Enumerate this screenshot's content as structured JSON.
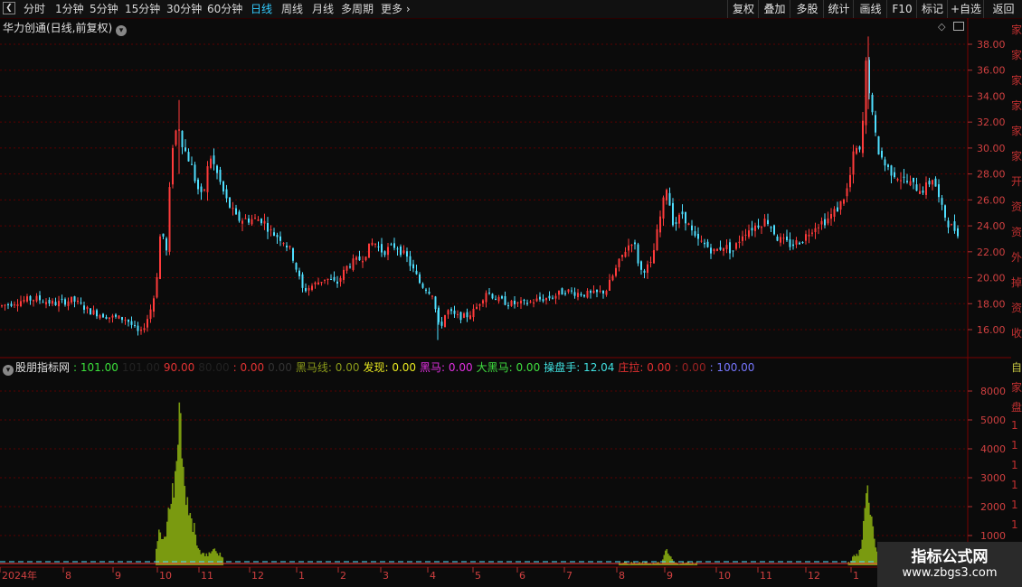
{
  "toolbar": {
    "periods": [
      "分时",
      "1分钟",
      "5分钟",
      "15分钟",
      "30分钟",
      "60分钟",
      "日线",
      "周线",
      "月线",
      "多周期",
      "更多"
    ],
    "active_period": "日线",
    "right_buttons": [
      "复权",
      "叠加",
      "多股",
      "统计",
      "画线",
      "F10",
      "标记",
      "+自选",
      "返回"
    ]
  },
  "stock": {
    "title": "华力创通(日线,前复权)"
  },
  "indicator": {
    "name": "股朋指标网",
    "items": [
      {
        "label": "",
        "value": ": 101.00",
        "color": "#3be03b"
      },
      {
        "label": "",
        "value": "101.00",
        "color": "#222222"
      },
      {
        "label": "",
        "value": "90.00",
        "color": "#e33333"
      },
      {
        "label": "",
        "value": "80.00",
        "color": "#222222"
      },
      {
        "label": "",
        "value": ": 0.00",
        "color": "#e33333"
      },
      {
        "label": "",
        "value": "0.00",
        "color": "#333333"
      },
      {
        "label": "黑马线",
        "value": ": 0.00",
        "color": "#8a9a1a"
      },
      {
        "label": "发现",
        "value": ": 0.00",
        "color": "#e8e820"
      },
      {
        "label": "黑马",
        "value": ": 0.00",
        "color": "#e030e0"
      },
      {
        "label": "大黑马",
        "value": ": 0.00",
        "color": "#40e040"
      },
      {
        "label": "操盘手",
        "value": ": 12.04",
        "color": "#40e0e0"
      },
      {
        "label": "庄拉",
        "value": ": 0.00",
        "color": "#e03030"
      },
      {
        "label": "",
        "value": ": 0.00",
        "color": "#992222"
      },
      {
        "label": "",
        "value": ": 100.00",
        "color": "#7777ff"
      }
    ]
  },
  "price_axis": [
    "38.00",
    "36.00",
    "34.00",
    "32.00",
    "30.00",
    "28.00",
    "26.00",
    "24.00",
    "22.00",
    "20.00",
    "18.00",
    "16.00"
  ],
  "volume_axis": [
    "8000",
    "5000",
    "4000",
    "3000",
    "2000",
    "1000"
  ],
  "x_axis": [
    "2024年",
    "8",
    "9",
    "10",
    "11",
    "12",
    "1",
    "2",
    "3",
    "4",
    "5",
    "6",
    "7",
    "8",
    "9",
    "10",
    "11",
    "12",
    "1"
  ],
  "watermark": {
    "line1": "指标公式网",
    "line2": "www.zbgs3.com"
  },
  "side_chars": [
    "家",
    "家",
    "家",
    "家",
    "家",
    "家",
    "开",
    "资",
    "资",
    "外",
    "掉",
    "资",
    "收"
  ],
  "side_chars2": [
    "自",
    "家",
    "盘",
    "1",
    "1",
    "1",
    "1",
    "1",
    "1"
  ],
  "colors": {
    "up": "#ff3b3b",
    "down": "#4fdfff",
    "bars": "#7a9a10",
    "grid": "#5a0000"
  }
}
